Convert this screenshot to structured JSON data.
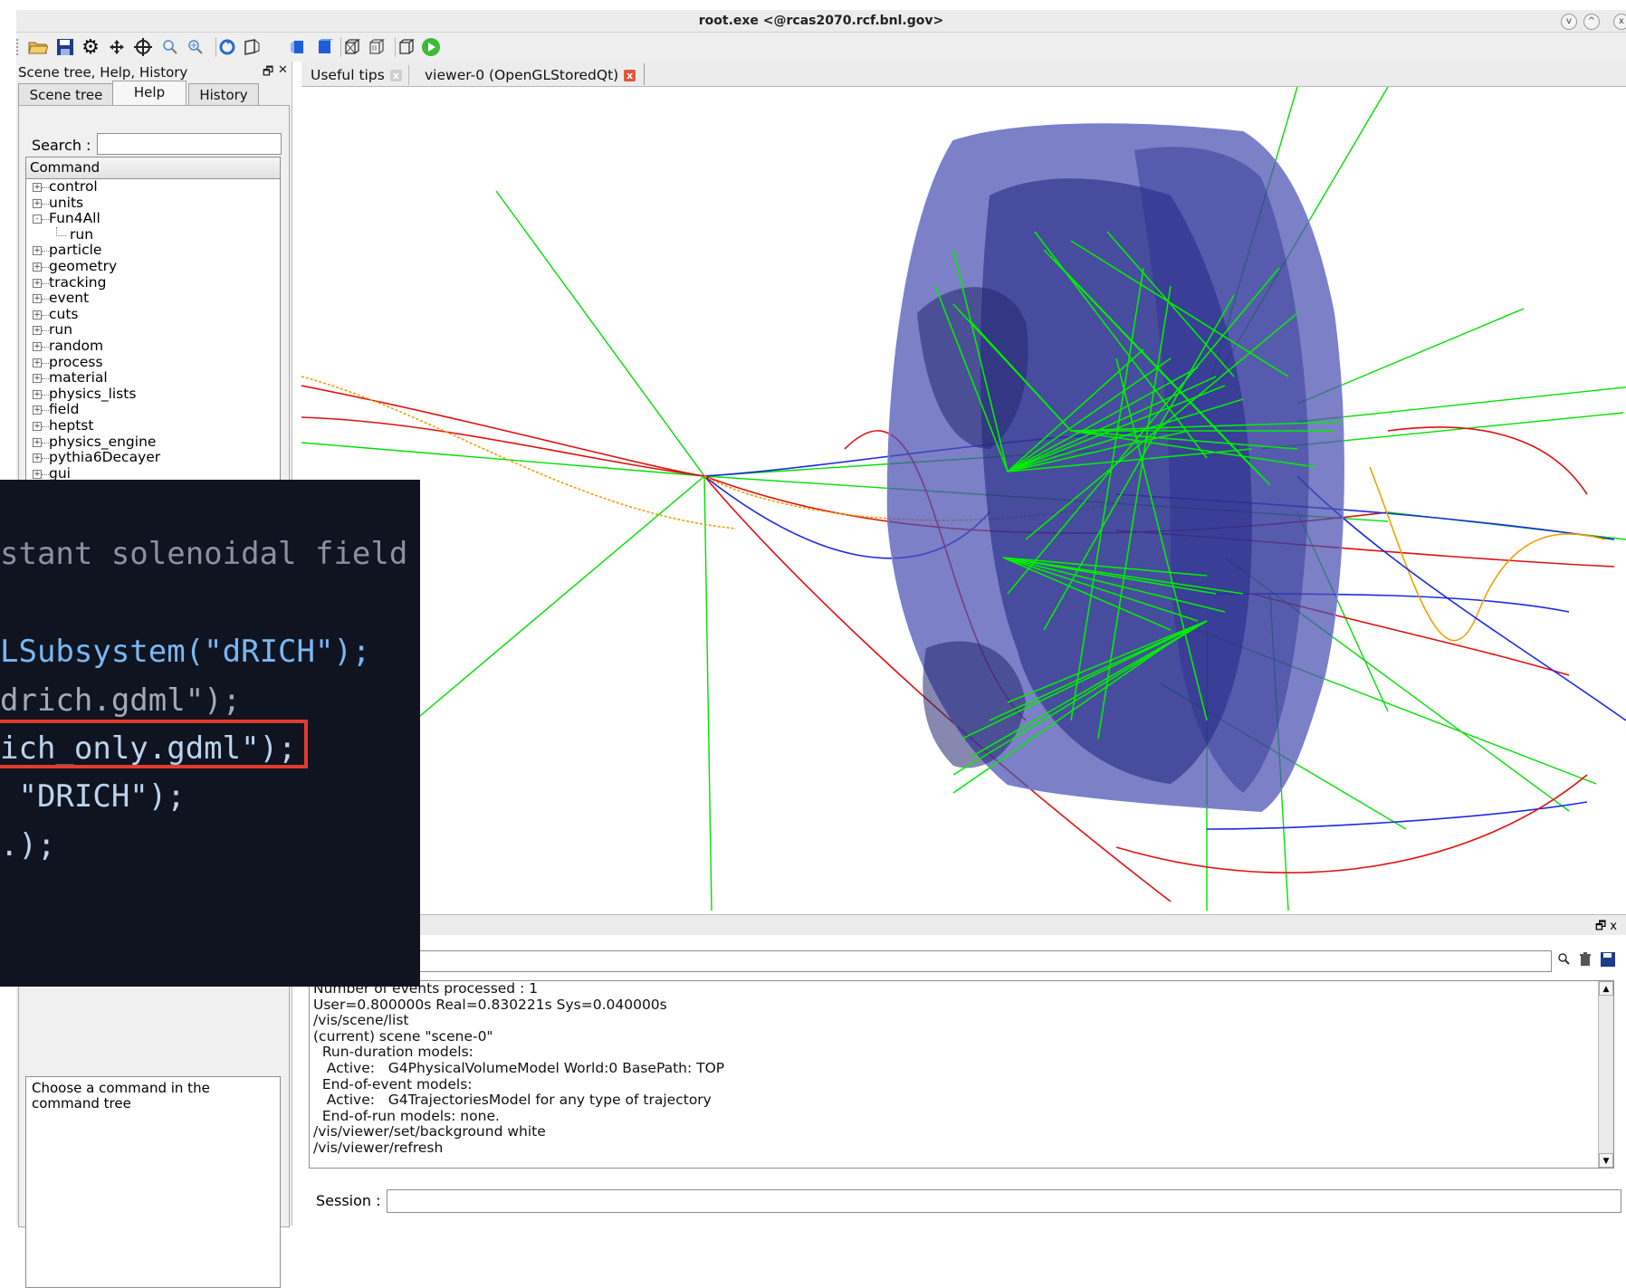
{
  "window": {
    "title": "root.exe <@rcas2070.rcf.bnl.gov>",
    "controls": [
      "v",
      "^",
      "x"
    ]
  },
  "toolbar": {
    "icons": [
      "grip-icon",
      "open-folder-icon",
      "save-icon",
      "gear-icon",
      "move-icon",
      "crosshair-icon",
      "zoom-out-icon",
      "zoom-in-icon",
      "rotate-icon",
      "perspective-icon",
      "front-view-icon",
      "solid-view-icon",
      "wireframe-icon",
      "hidden-line-icon",
      "surface-icon",
      "hidden-surface-icon",
      "run-icon"
    ]
  },
  "dock": {
    "title": "Scene tree, Help, History",
    "float_glyph": "🗗",
    "close_glyph": "✕",
    "tabs": [
      {
        "label": "Scene tree"
      },
      {
        "label": "Help"
      },
      {
        "label": "History"
      }
    ],
    "search_label": "Search :",
    "search_value": "",
    "tree_header": "Command",
    "tree": [
      {
        "label": "control",
        "expander": "+"
      },
      {
        "label": "units",
        "expander": "+"
      },
      {
        "label": "Fun4All",
        "expander": "-"
      },
      {
        "label": "run",
        "child": true
      },
      {
        "label": "particle",
        "expander": "+"
      },
      {
        "label": "geometry",
        "expander": "+"
      },
      {
        "label": "tracking",
        "expander": "+"
      },
      {
        "label": "event",
        "expander": "+"
      },
      {
        "label": "cuts",
        "expander": "+"
      },
      {
        "label": "run",
        "expander": "+"
      },
      {
        "label": "random",
        "expander": "+"
      },
      {
        "label": "process",
        "expander": "+"
      },
      {
        "label": "material",
        "expander": "+"
      },
      {
        "label": "physics_lists",
        "expander": "+"
      },
      {
        "label": "field",
        "expander": "+"
      },
      {
        "label": "heptst",
        "expander": "+"
      },
      {
        "label": "physics_engine",
        "expander": "+"
      },
      {
        "label": "pythia6Decayer",
        "expander": "+"
      },
      {
        "label": "gui",
        "expander": "+"
      }
    ],
    "help_text": "Choose a command in the command tree"
  },
  "viewer_tabs": [
    {
      "label": "Useful tips",
      "close": "x",
      "active": false
    },
    {
      "label": "viewer-0 (OpenGLStoredQt)",
      "close": "x",
      "active": true
    }
  ],
  "output": {
    "float_glyph": "🗗 x",
    "filter_value": "",
    "filter_icons": [
      "search-icon",
      "trash-icon",
      "save-icon"
    ],
    "lines": [
      "Number of events processed : 1",
      "User=0.800000s Real=0.830221s Sys=0.040000s",
      "/vis/scene/list",
      "(current) scene \"scene-0\"",
      "  Run-duration models:",
      "   Active:   G4PhysicalVolumeModel World:0 BasePath: TOP",
      "  End-of-event models:",
      "   Active:   G4TrajectoriesModel for any type of trajectory",
      "  End-of-run models: none.",
      "/vis/viewer/set/background white",
      "/vis/viewer/refresh"
    ],
    "scroll_up": "▲",
    "scroll_down": "▼"
  },
  "session": {
    "label": "Session :",
    "value": ""
  },
  "code_overlay": {
    "lines": [
      "stant solenoidal field",
      "LSubsystem(\"dRICH\");",
      "drich.gdml\");",
      "ich_only.gdml\");",
      " \"DRICH\");",
      ".);"
    ]
  },
  "colors": {
    "detector_fill": "#4a4fb0",
    "track_green": "#00e000",
    "track_red": "#e01010",
    "track_blue": "#1a2be0",
    "track_orange": "#f0a000",
    "highlight": "#e23b2e",
    "code_bg": "#0f1420"
  }
}
